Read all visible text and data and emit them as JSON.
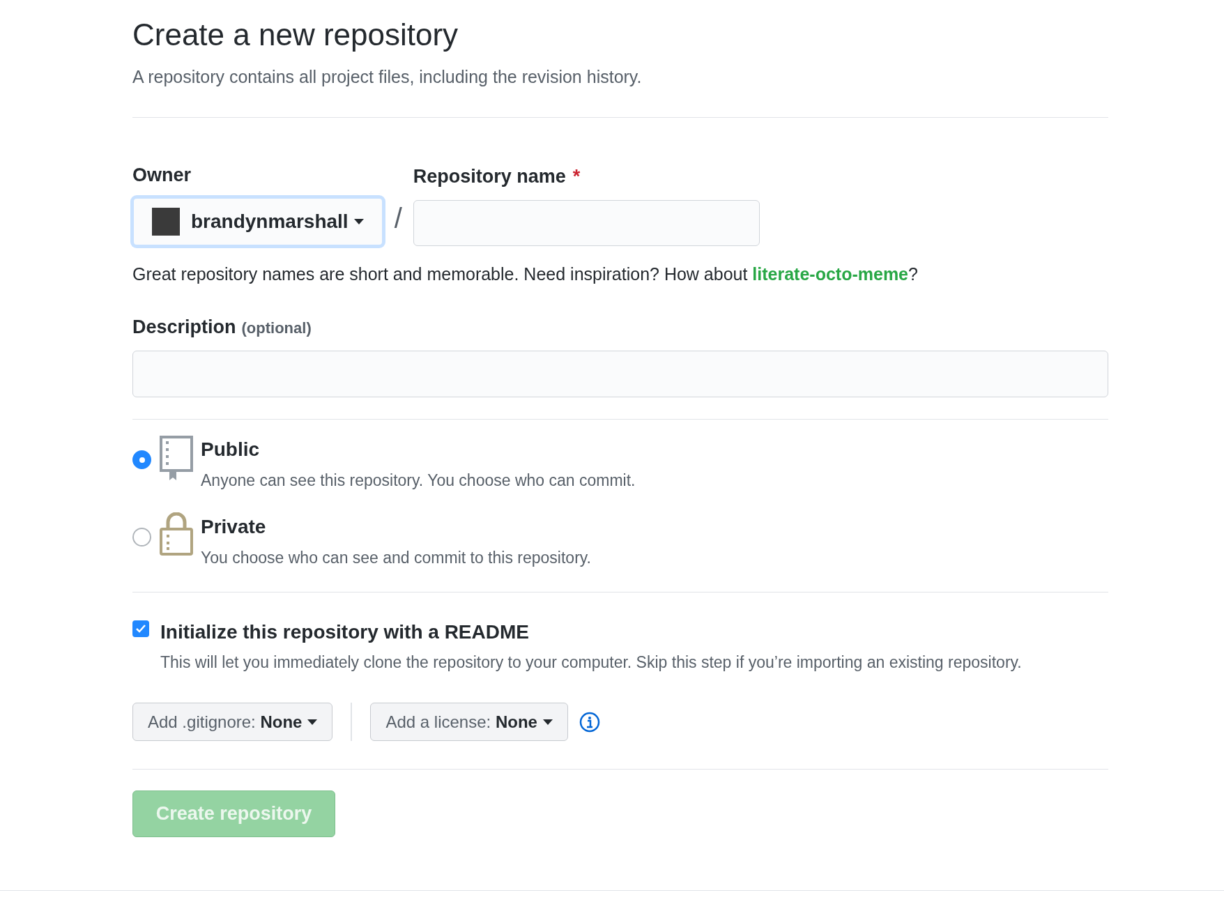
{
  "title": "Create a new repository",
  "subtitle": "A repository contains all project files, including the revision history.",
  "owner": {
    "label": "Owner",
    "value": "brandynmarshall"
  },
  "separator": "/",
  "repo_name": {
    "label": "Repository name",
    "required_mark": "*"
  },
  "hint": {
    "before": "Great repository names are short and memorable. Need inspiration? How about ",
    "link": "literate-octo-meme",
    "after": "?"
  },
  "description": {
    "label": "Description",
    "optional": "(optional)"
  },
  "visibility": [
    {
      "kind": "public",
      "title": "Public",
      "description": "Anyone can see this repository. You choose who can commit.",
      "selected": true
    },
    {
      "kind": "private",
      "title": "Private",
      "description": "You choose who can see and commit to this repository.",
      "selected": false
    }
  ],
  "readme": {
    "label": "Initialize this repository with a README",
    "description": "This will let you immediately clone the repository to your computer. Skip this step if you’re importing an existing repository.",
    "checked": true
  },
  "gitignore": {
    "label": "Add .gitignore:",
    "value": "None"
  },
  "license": {
    "label": "Add a license:",
    "value": "None"
  },
  "create_button": {
    "label": "Create repository",
    "disabled": true
  }
}
